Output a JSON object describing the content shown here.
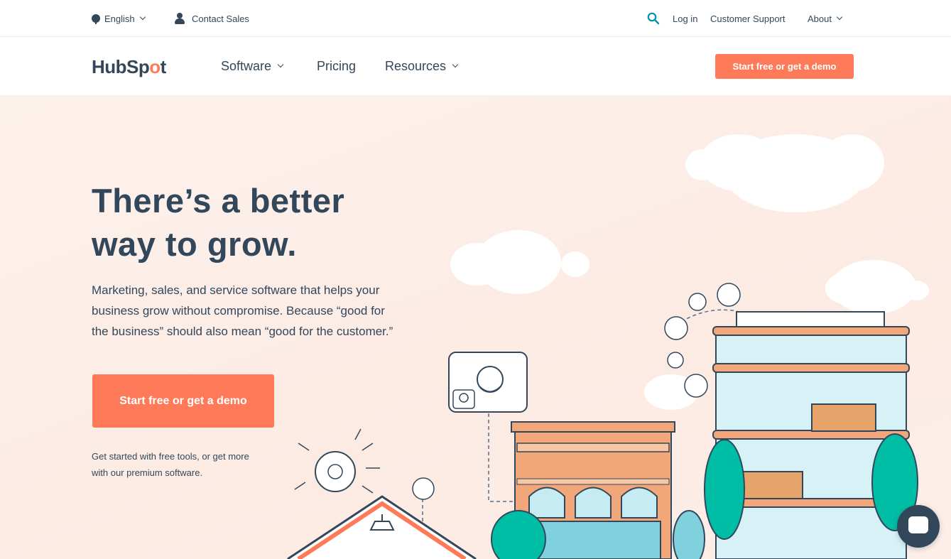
{
  "utility": {
    "language": "English",
    "contact": "Contact Sales",
    "login": "Log in",
    "support": "Customer Support",
    "about": "About"
  },
  "nav": {
    "logo_a": "HubSp",
    "logo_b": "o",
    "logo_c": "t",
    "software": "Software",
    "pricing": "Pricing",
    "resources": "Resources",
    "cta": "Start free or get a demo"
  },
  "hero": {
    "title_line1": "There’s a better",
    "title_line2": "way to grow.",
    "text": "Marketing, sales, and service software that helps your business grow without compromise. Because “good for the business” should also mean “good for the customer.”",
    "cta": "Start free or get a demo",
    "subtext": "Get started with free tools, or get more with our premium software."
  },
  "colors": {
    "accent": "#ff7a59",
    "text": "#33475b",
    "hero_bg": "#fcefe9",
    "teal": "#00bda5"
  }
}
